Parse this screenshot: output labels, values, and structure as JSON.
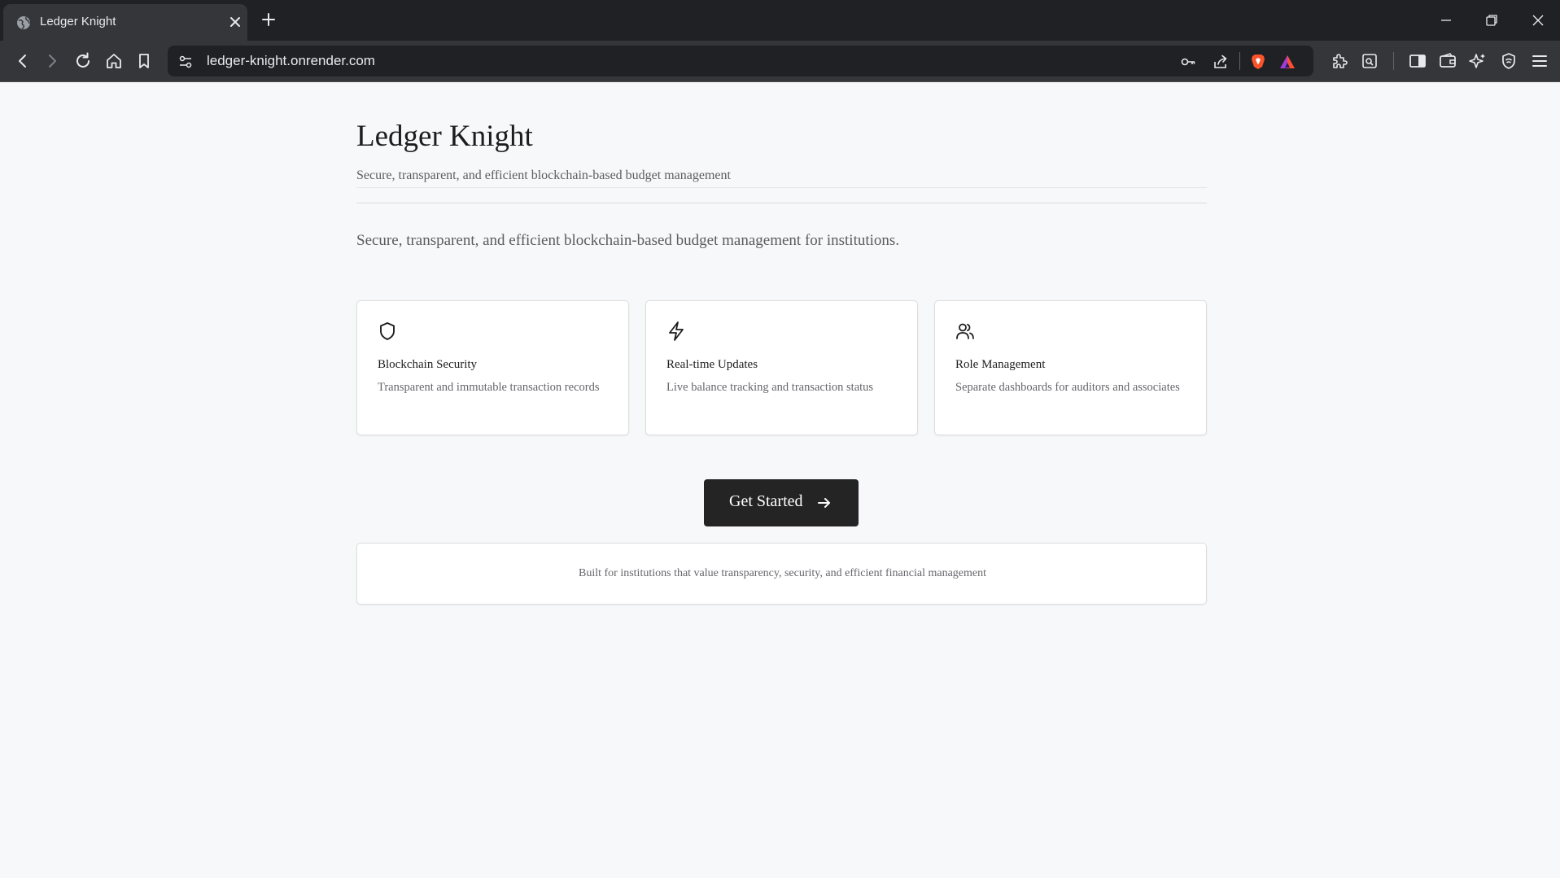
{
  "browser": {
    "tab_title": "Ledger Knight",
    "url": "ledger-knight.onrender.com",
    "icons": {
      "tab": "globe-icon",
      "tab_close": "close-icon",
      "new_tab": "plus-icon",
      "back": "back-arrow-icon",
      "forward": "forward-arrow-icon",
      "reload": "reload-icon",
      "home": "home-icon",
      "bookmark": "bookmark-icon",
      "site_settings": "tune-icon",
      "password": "key-icon",
      "share": "share-icon",
      "shields": "brave-shields-icon",
      "rewards": "brave-rewards-icon",
      "extensions": "puzzle-icon",
      "reader": "reader-mode-icon",
      "sidebar": "sidebar-icon",
      "wallet": "wallet-icon",
      "leo": "sparkle-icon",
      "vpn": "vpn-shield-icon",
      "menu": "hamburger-menu-icon"
    }
  },
  "header": {
    "title": "Ledger Knight",
    "subtitle": "Secure, transparent, and efficient blockchain-based budget management"
  },
  "lead": "Secure, transparent, and efficient blockchain-based budget management for institutions.",
  "features": [
    {
      "icon": "shield-icon",
      "title": "Blockchain Security",
      "description": "Transparent and immutable transaction records"
    },
    {
      "icon": "lightning-icon",
      "title": "Real-time Updates",
      "description": "Live balance tracking and transaction status"
    },
    {
      "icon": "users-icon",
      "title": "Role Management",
      "description": "Separate dashboards for auditors and associates"
    }
  ],
  "cta": {
    "label": "Get Started",
    "icon": "arrow-right-icon"
  },
  "footer": {
    "text": "Built for institutions that value transparency, security, and efficient financial management"
  },
  "colors": {
    "page_bg": "#f7f8f9",
    "chrome_dark": "#202124",
    "chrome_tab": "#35363a",
    "button_bg": "#242424",
    "text_primary": "#1d1d1f",
    "text_muted": "#66666b"
  }
}
